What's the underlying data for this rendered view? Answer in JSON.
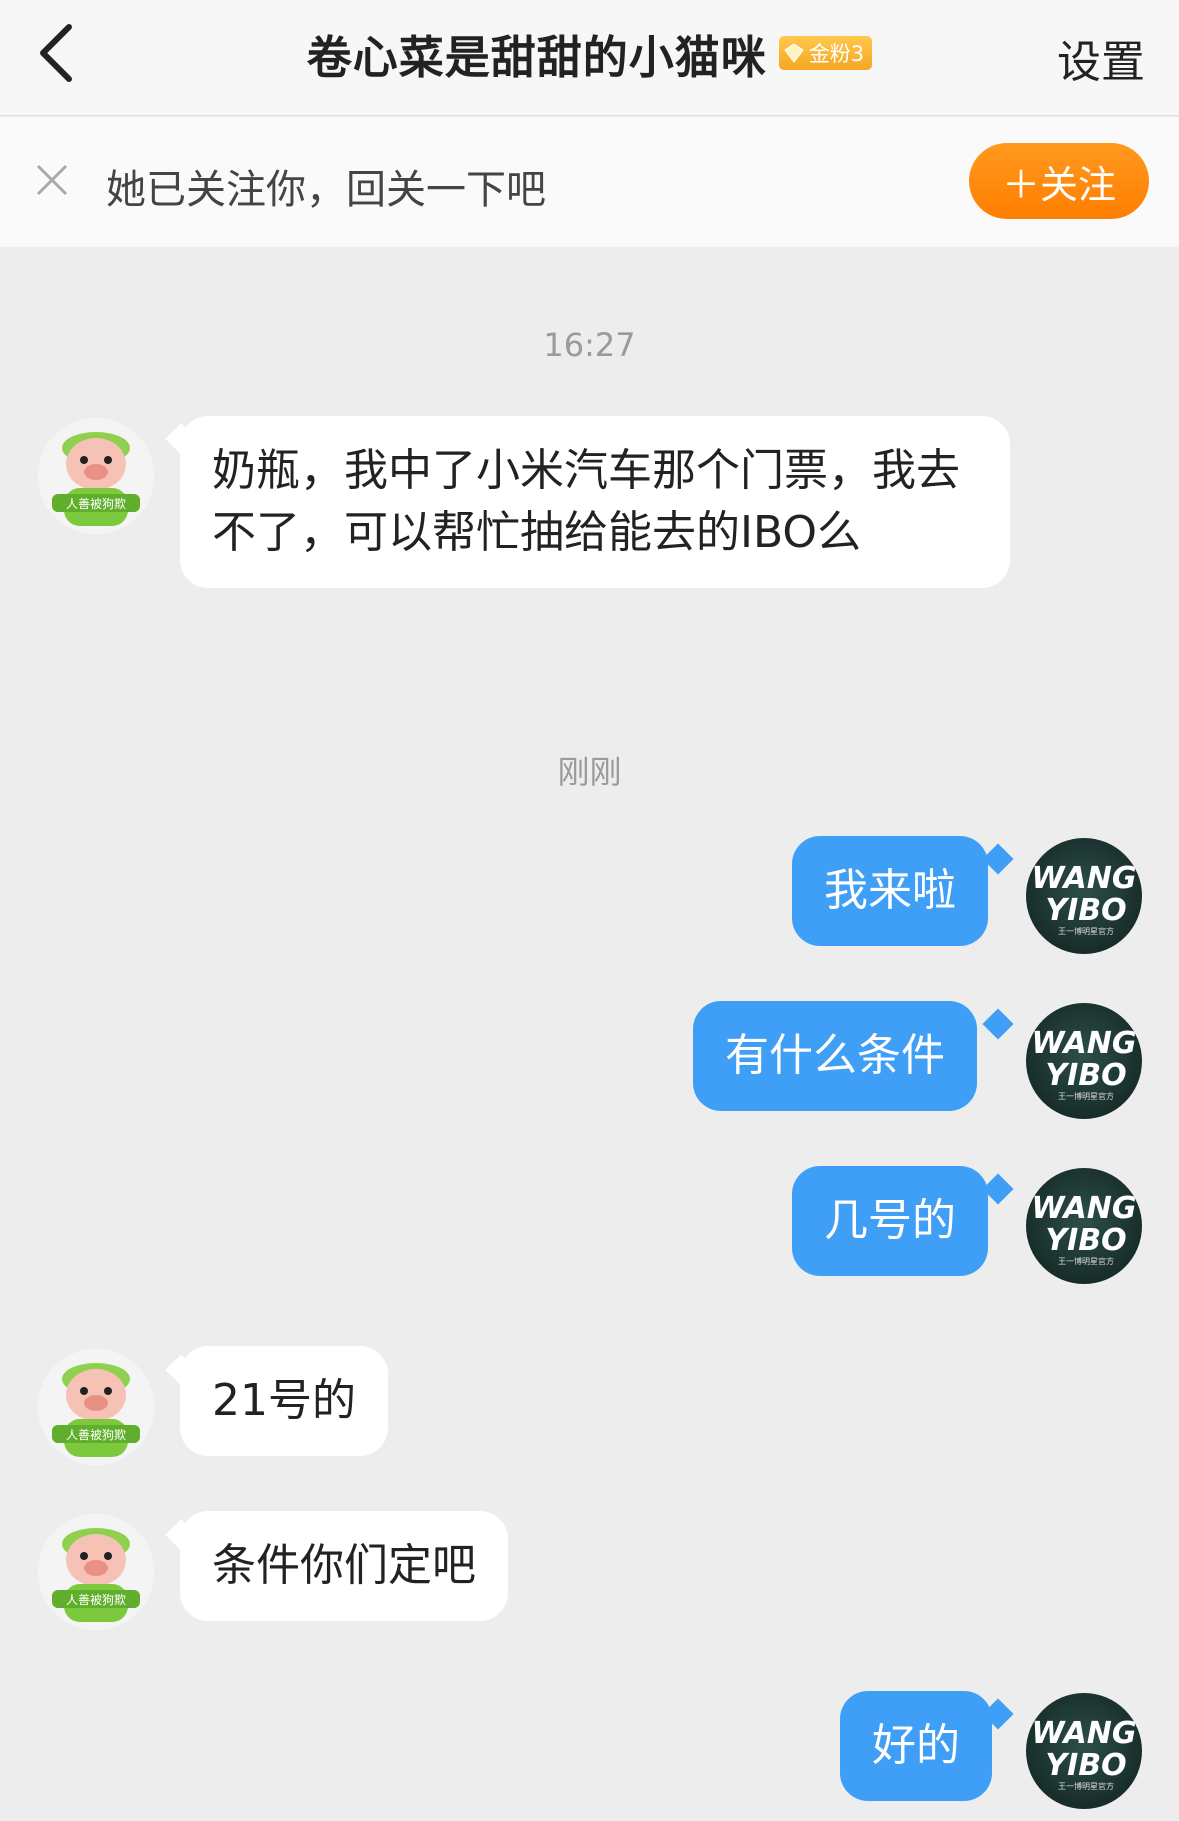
{
  "header": {
    "title": "卷心菜是甜甜的小猫咪",
    "fan_badge": "金粉3",
    "settings_label": "设置"
  },
  "follow_banner": {
    "text": "她已关注你，回关一下吧",
    "button_label": "＋关注"
  },
  "colors": {
    "outgoing_bubble": "#3f9ef5",
    "follow_button": "#ff8a00",
    "badge": "#f5a623"
  },
  "timestamps": [
    "16:27",
    "刚刚"
  ],
  "avatars": {
    "other_badge_text": "人善被狗欺",
    "self_logo_line1": "WANG",
    "self_logo_line2": "YIBO",
    "self_logo_small": "王一博明星官方"
  },
  "messages": [
    {
      "side": "in",
      "text": "奶瓶，我中了小米汽车那个门票，我去不了，可以帮忙抽给能去的IBO么"
    },
    {
      "side": "out",
      "text": "我来啦"
    },
    {
      "side": "out",
      "text": "有什么条件"
    },
    {
      "side": "out",
      "text": "几号的"
    },
    {
      "side": "in",
      "text": "21号的"
    },
    {
      "side": "in",
      "text": "条件你们定吧"
    },
    {
      "side": "out",
      "text": "好的"
    }
  ]
}
